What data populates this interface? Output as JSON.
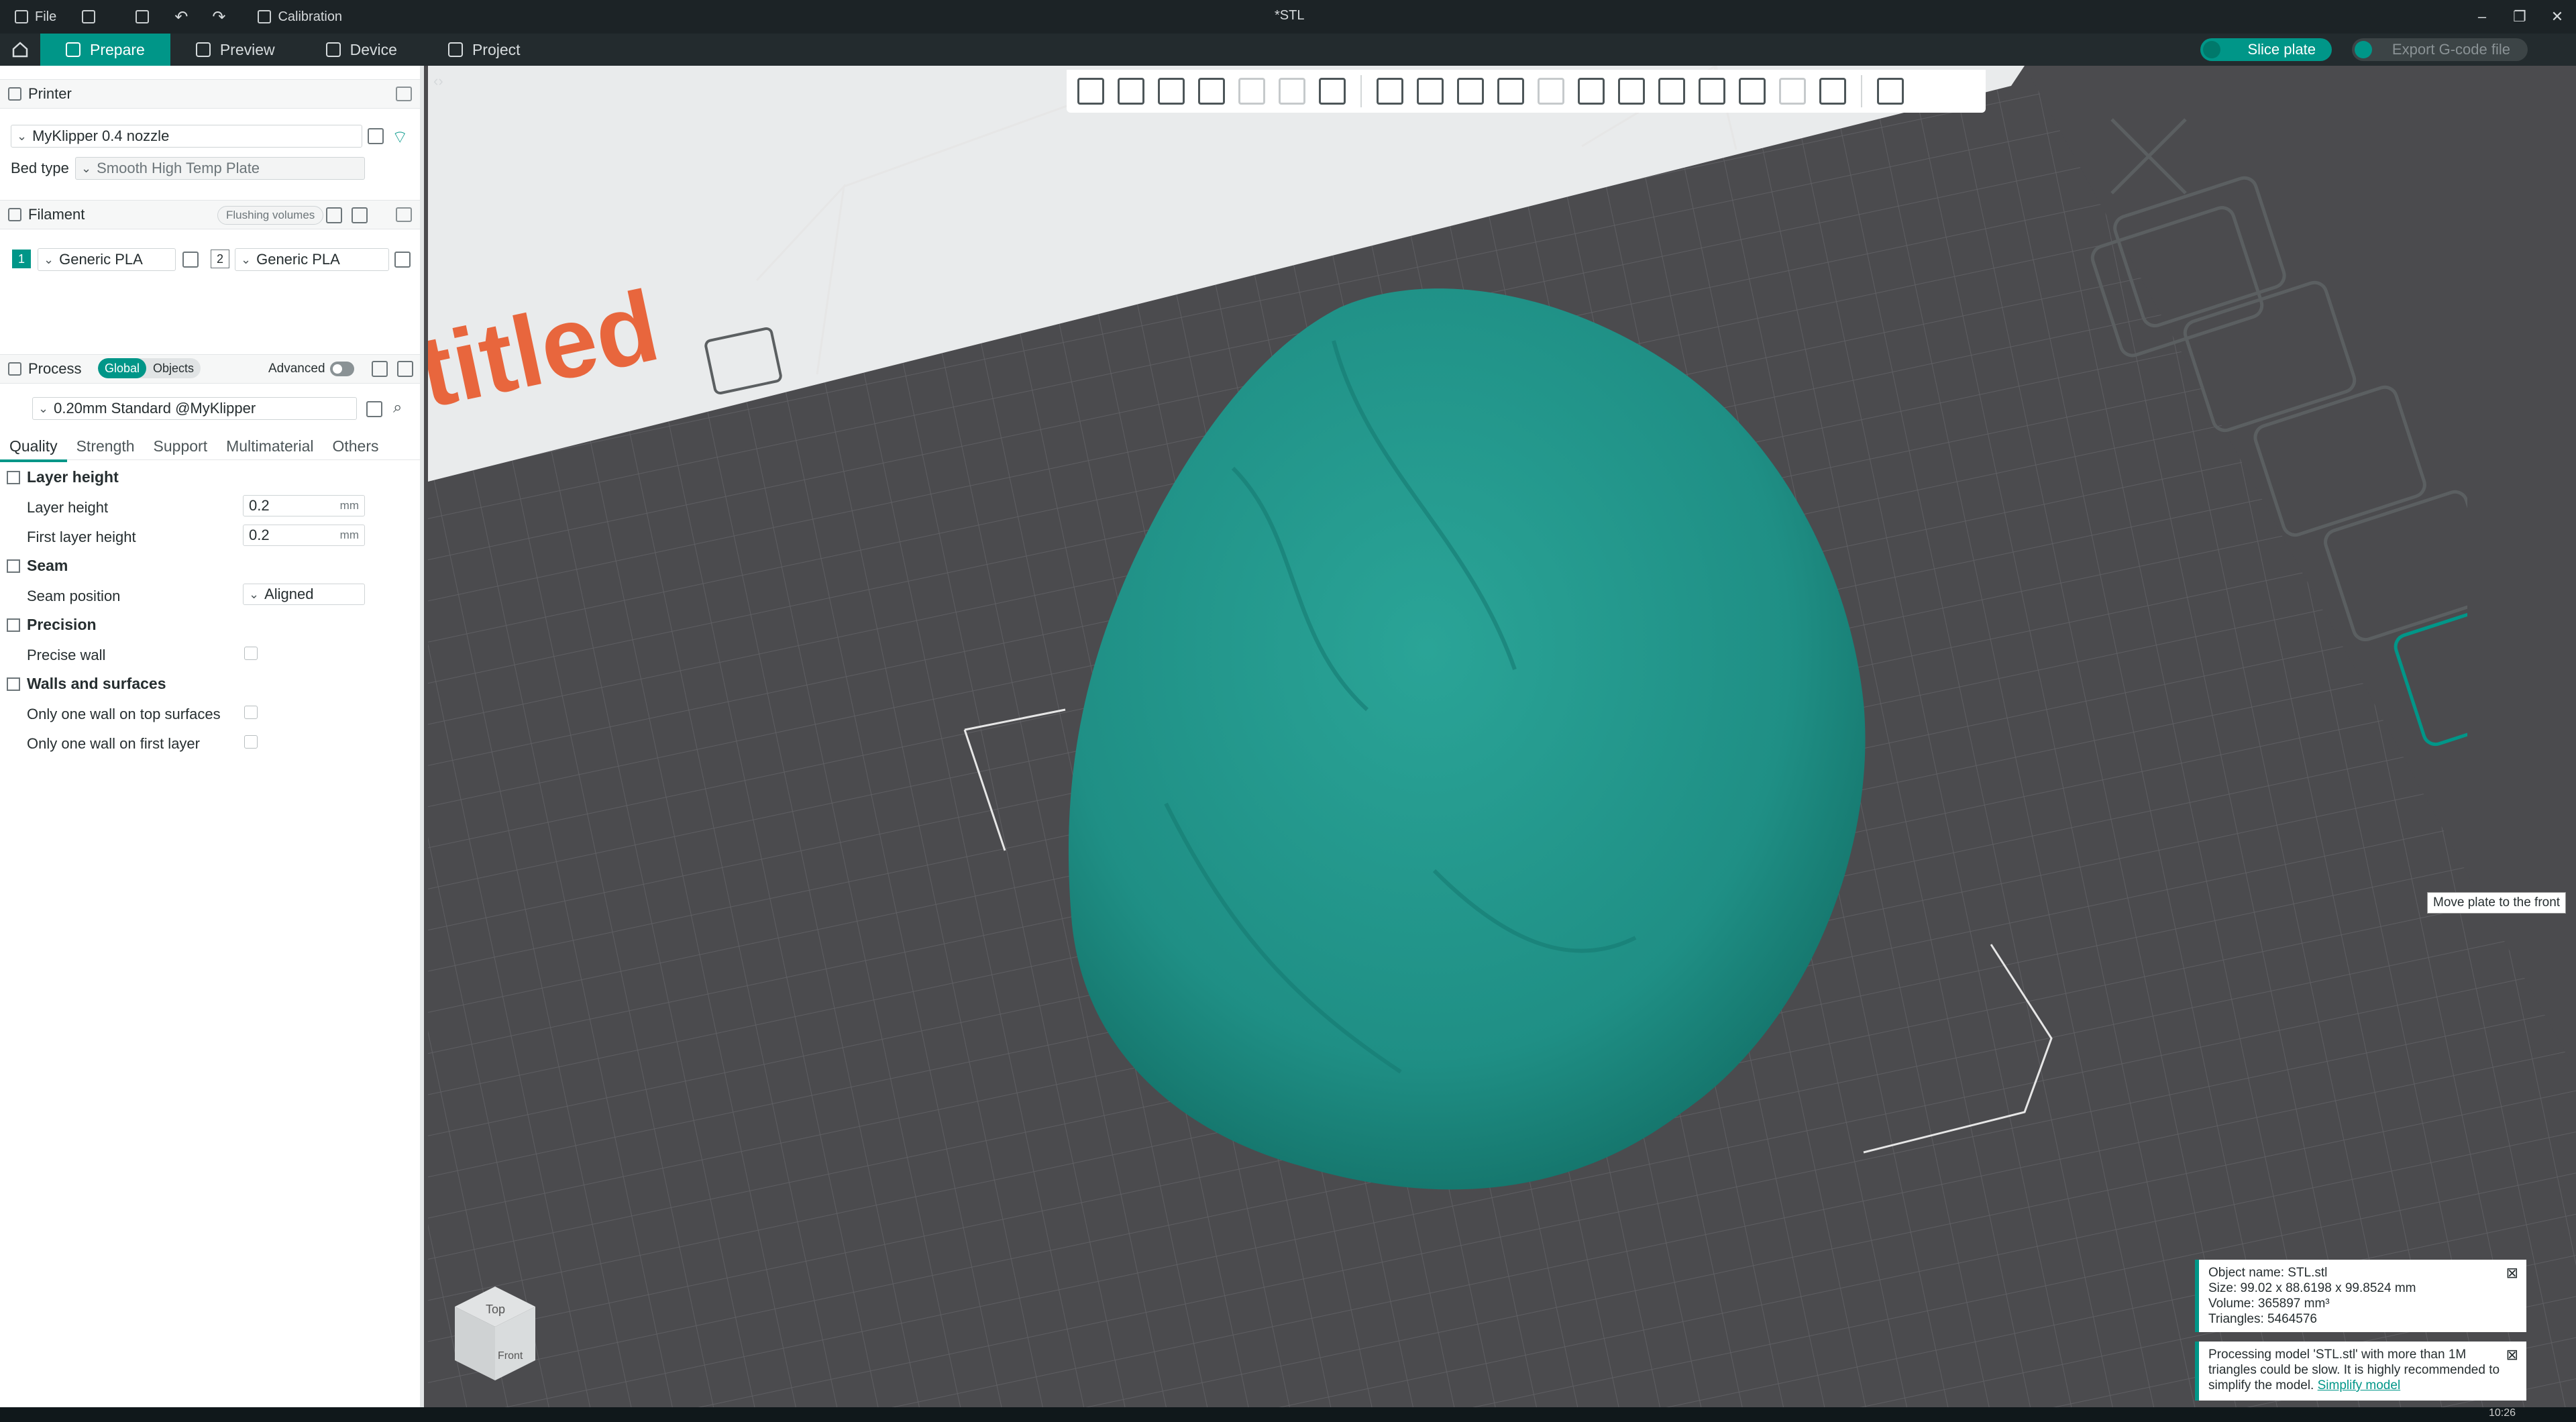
{
  "titlebar": {
    "menu_file": "File",
    "calibration": "Calibration",
    "document_title": "*STL"
  },
  "tabs": [
    {
      "label": "Prepare"
    },
    {
      "label": "Preview"
    },
    {
      "label": "Device"
    },
    {
      "label": "Project"
    }
  ],
  "actions": {
    "slice": "Slice plate",
    "export": "Export G-code file"
  },
  "printer": {
    "section": "Printer",
    "name": "MyKlipper 0.4 nozzle",
    "bed_type_label": "Bed type",
    "bed_type_value": "Smooth High Temp Plate"
  },
  "filament": {
    "section": "Filament",
    "flushing": "Flushing volumes",
    "slots": [
      {
        "num": "1",
        "name": "Generic PLA",
        "color": "#009688"
      },
      {
        "num": "2",
        "name": "Generic PLA",
        "color": "#ffffff"
      }
    ]
  },
  "process": {
    "section": "Process",
    "seg_global": "Global",
    "seg_objects": "Objects",
    "advanced": "Advanced",
    "preset": "0.20mm Standard @MyKlipper"
  },
  "subtabs": [
    "Quality",
    "Strength",
    "Support",
    "Multimaterial",
    "Others"
  ],
  "quality": {
    "layer_height_group": "Layer height",
    "layer_height_label": "Layer height",
    "layer_height_value": "0.2",
    "first_layer_label": "First layer height",
    "first_layer_value": "0.2",
    "unit": "mm",
    "seam_group": "Seam",
    "seam_position_label": "Seam position",
    "seam_position_value": "Aligned",
    "precision_group": "Precision",
    "precise_wall_label": "Precise wall",
    "walls_group": "Walls and surfaces",
    "one_wall_top_label": "Only one wall on top surfaces",
    "one_wall_first_label": "Only one wall on first layer"
  },
  "plate": {
    "name_text": "titled",
    "cube_top": "Top",
    "cube_front": "Front"
  },
  "tooltip": "Move plate to the front",
  "object_info": {
    "name": "Object name: STL.stl",
    "size": "Size: 99.02 x 88.6198 x 99.8524 mm",
    "volume": "Volume: 365897 mm³",
    "triangles": "Triangles: 5464576"
  },
  "warning": {
    "text": "Processing model 'STL.stl' with more than 1M triangles could be slow. It is highly recommended to simplify the model.",
    "link": "Simplify model"
  },
  "colors": {
    "accent": "#009688",
    "model": "#1f8f85",
    "bed": "#4b4b4e",
    "plate_text": "#e8663d"
  },
  "clock": "10:26"
}
